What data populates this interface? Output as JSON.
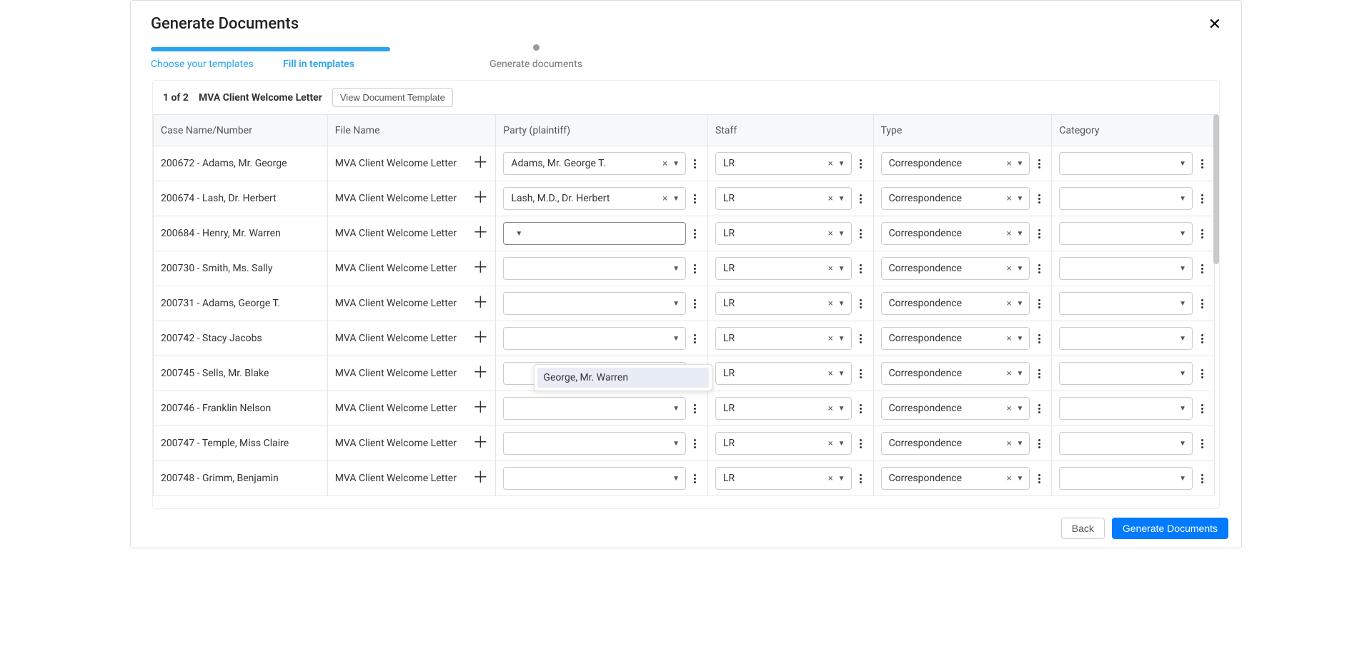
{
  "title": "Generate Documents",
  "stepper": {
    "step1": "Choose your templates",
    "step2": "Fill in templates",
    "step3": "Generate documents"
  },
  "panel": {
    "page_of": "1 of 2",
    "doc_title": "MVA Client Welcome Letter",
    "view_button": "View Document Template"
  },
  "headers": {
    "case": "Case Name/Number",
    "file": "File Name",
    "party": "Party (plaintiff)",
    "staff": "Staff",
    "type": "Type",
    "category": "Category"
  },
  "dropdown_option": "George, Mr. Warren",
  "rows": [
    {
      "case": "200672 - Adams, Mr. George",
      "file": "MVA Client Welcome Letter",
      "party": "Adams, Mr. George T.",
      "staff": "LR",
      "type": "Correspondence",
      "category": "",
      "focused": false,
      "dropdown": false
    },
    {
      "case": "200674 - Lash, Dr. Herbert",
      "file": "MVA Client Welcome Letter",
      "party": "Lash, M.D., Dr. Herbert",
      "staff": "LR",
      "type": "Correspondence",
      "category": "",
      "focused": false,
      "dropdown": false
    },
    {
      "case": "200684 - Henry, Mr. Warren",
      "file": "MVA Client Welcome Letter",
      "party": "",
      "staff": "LR",
      "type": "Correspondence",
      "category": "",
      "focused": true,
      "dropdown": true
    },
    {
      "case": "200730 - Smith, Ms. Sally",
      "file": "MVA Client Welcome Letter",
      "party": "",
      "staff": "LR",
      "type": "Correspondence",
      "category": "",
      "focused": false,
      "dropdown": false
    },
    {
      "case": "200731 - Adams, George T.",
      "file": "MVA Client Welcome Letter",
      "party": "",
      "staff": "LR",
      "type": "Correspondence",
      "category": "",
      "focused": false,
      "dropdown": false
    },
    {
      "case": "200742 - Stacy Jacobs",
      "file": "MVA Client Welcome Letter",
      "party": "",
      "staff": "LR",
      "type": "Correspondence",
      "category": "",
      "focused": false,
      "dropdown": false
    },
    {
      "case": "200745 - Sells, Mr. Blake",
      "file": "MVA Client Welcome Letter",
      "party": "",
      "staff": "LR",
      "type": "Correspondence",
      "category": "",
      "focused": false,
      "dropdown": false
    },
    {
      "case": "200746 - Franklin Nelson",
      "file": "MVA Client Welcome Letter",
      "party": "",
      "staff": "LR",
      "type": "Correspondence",
      "category": "",
      "focused": false,
      "dropdown": false
    },
    {
      "case": "200747 - Temple, Miss Claire",
      "file": "MVA Client Welcome Letter",
      "party": "",
      "staff": "LR",
      "type": "Correspondence",
      "category": "",
      "focused": false,
      "dropdown": false
    },
    {
      "case": "200748 - Grimm, Benjamin",
      "file": "MVA Client Welcome Letter",
      "party": "",
      "staff": "LR",
      "type": "Correspondence",
      "category": "",
      "focused": false,
      "dropdown": false
    }
  ],
  "footer": {
    "back": "Back",
    "generate": "Generate Documents"
  }
}
